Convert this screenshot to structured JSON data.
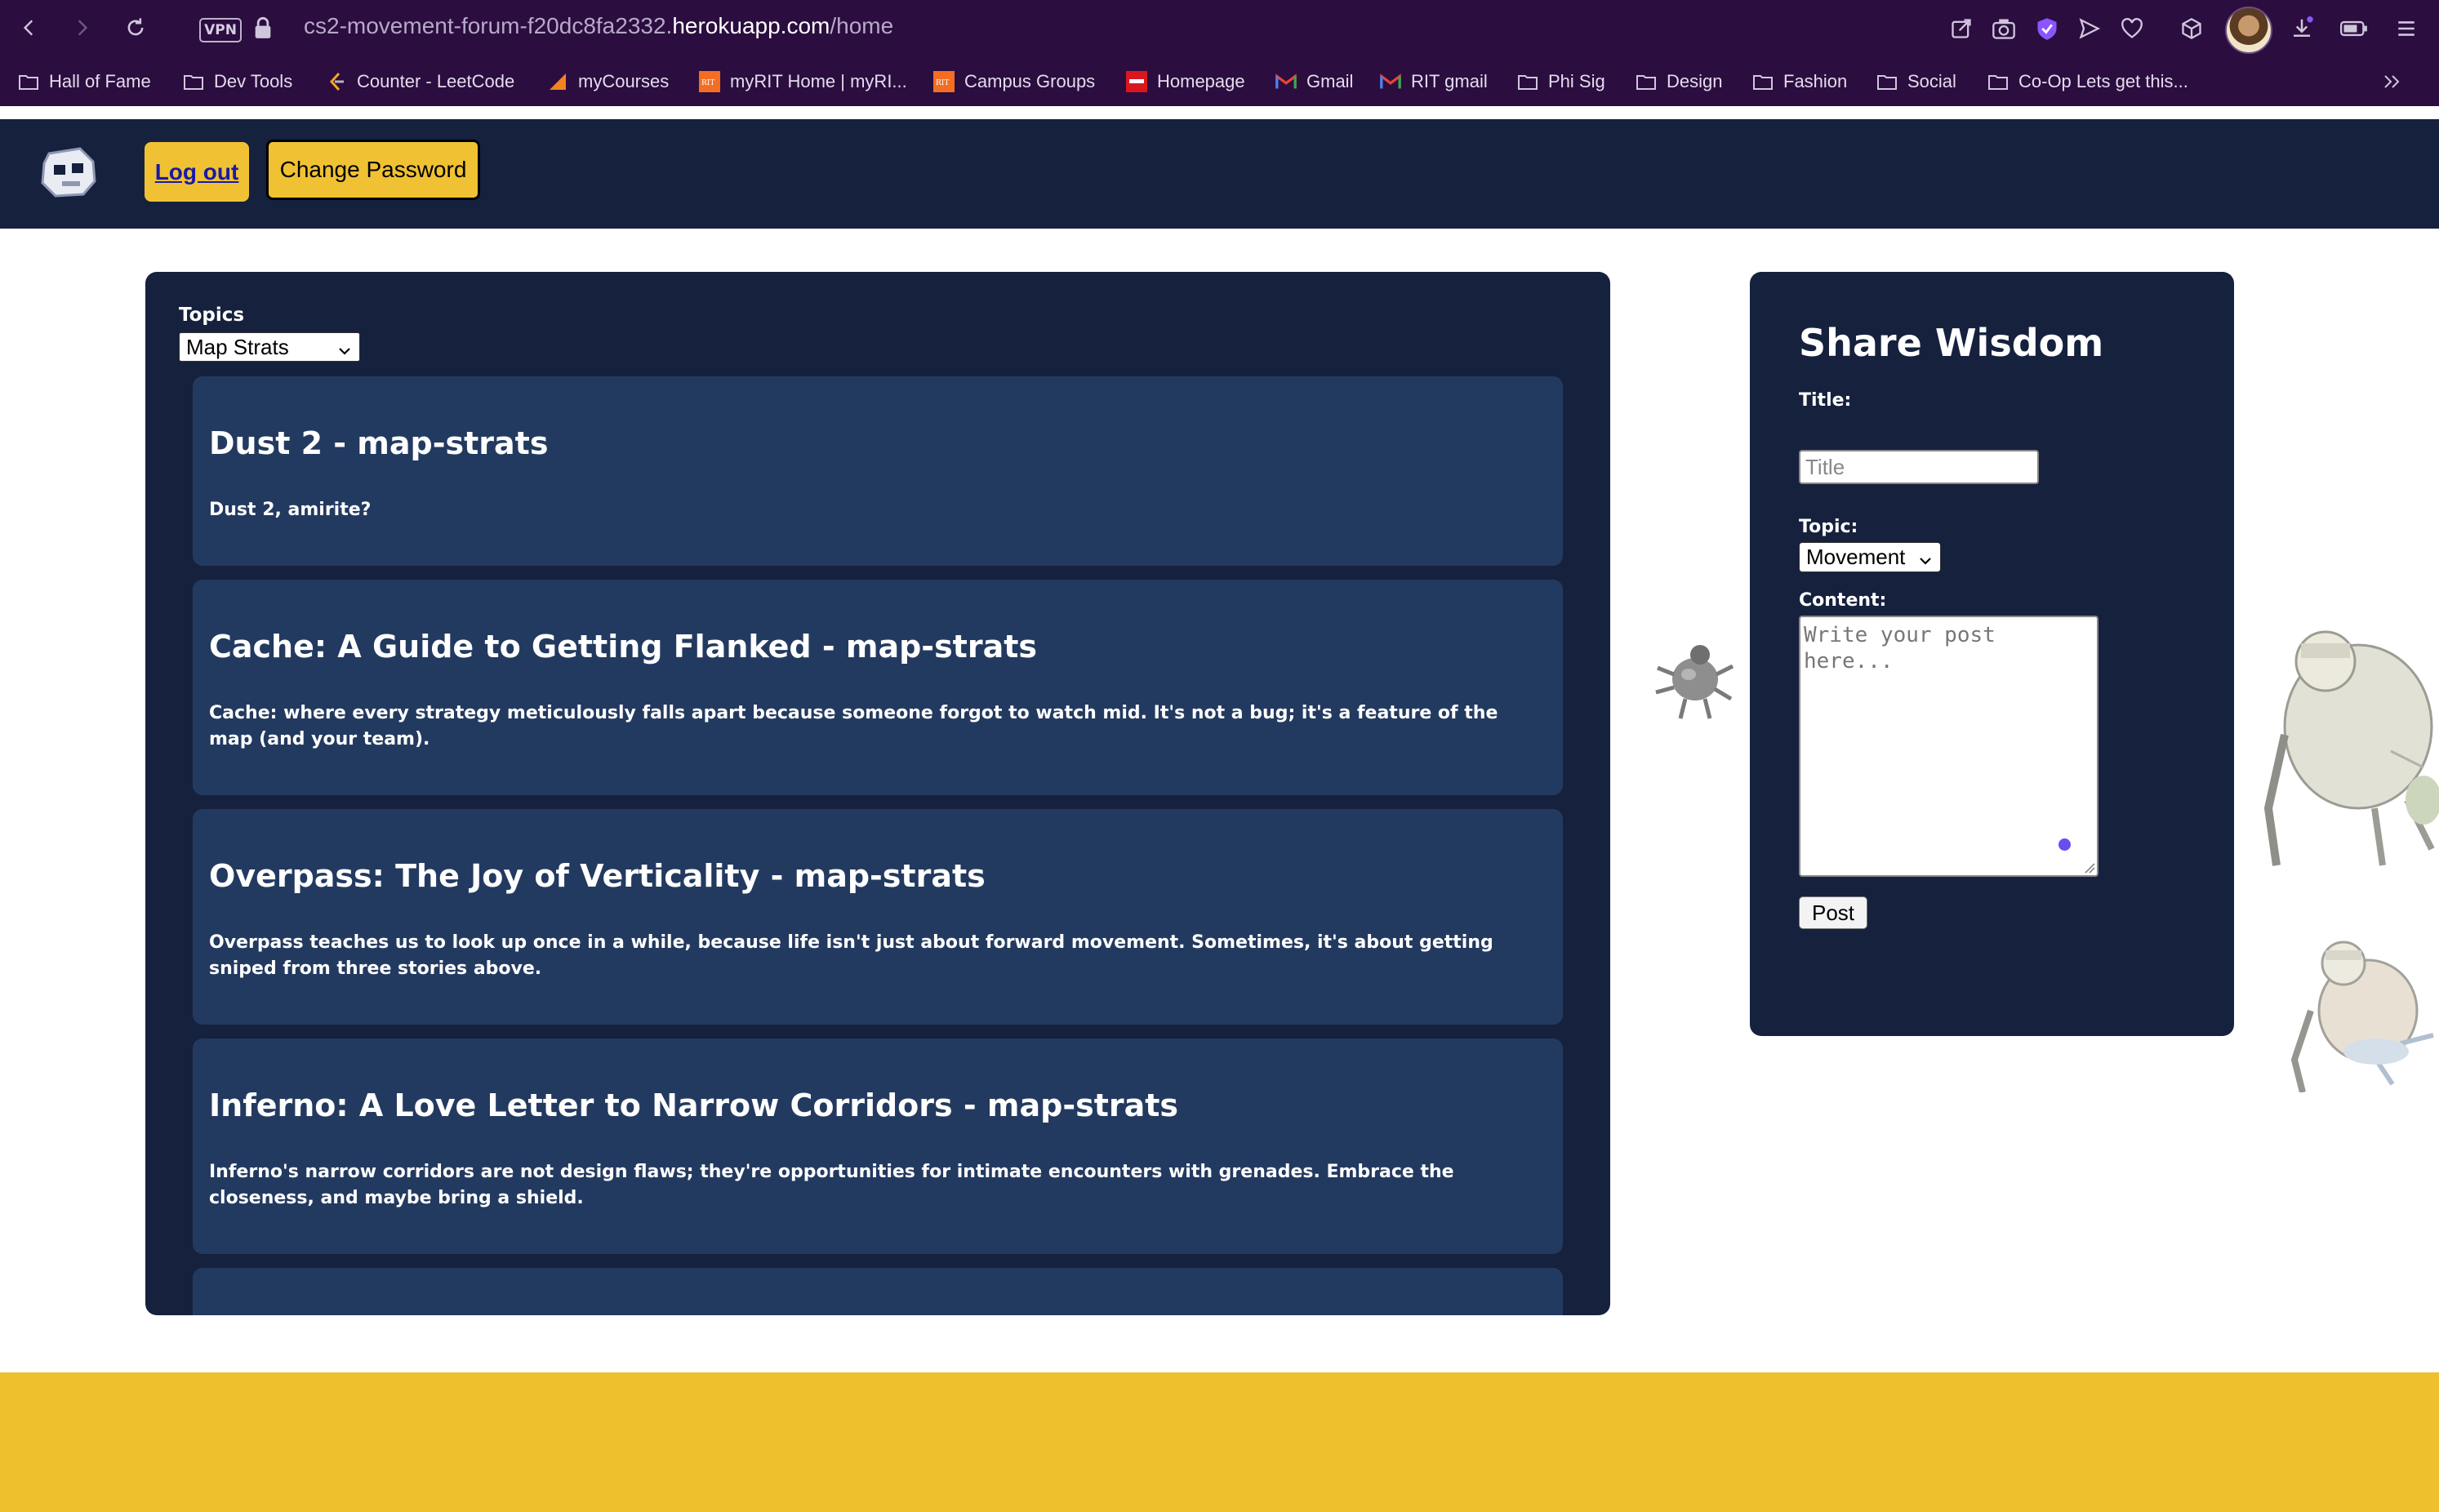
{
  "browser": {
    "vpn_label": "VPN",
    "url_prefix": "cs2-movement-forum-f20dc8fa2332.",
    "url_host": "herokuapp.com",
    "url_path": "/home",
    "bookmarks": [
      {
        "label": "Hall of Fame",
        "icon": "folder-icon"
      },
      {
        "label": "Dev Tools",
        "icon": "folder-icon"
      },
      {
        "label": "Counter - LeetCode",
        "icon": "leetcode-icon"
      },
      {
        "label": "myCourses",
        "icon": "mycourses-icon"
      },
      {
        "label": "myRIT Home | myRI...",
        "icon": "rit-icon"
      },
      {
        "label": "Campus Groups",
        "icon": "rit-icon"
      },
      {
        "label": "Homepage",
        "icon": "homepage-icon"
      },
      {
        "label": "Gmail",
        "icon": "gmail-icon"
      },
      {
        "label": "RIT gmail",
        "icon": "gmail-icon"
      },
      {
        "label": "Phi Sig",
        "icon": "folder-icon"
      },
      {
        "label": "Design",
        "icon": "folder-icon"
      },
      {
        "label": "Fashion",
        "icon": "folder-icon"
      },
      {
        "label": "Social",
        "icon": "folder-icon"
      },
      {
        "label": "Co-Op Lets get this...",
        "icon": "folder-icon"
      }
    ]
  },
  "header": {
    "logout_label": "Log out",
    "change_password_label": "Change Password"
  },
  "feed": {
    "topics_label": "Topics",
    "selected_topic": "Map Strats",
    "posts": [
      {
        "title": "Dust 2 - map-strats",
        "body": "Dust 2, amirite?"
      },
      {
        "title": "Cache: A Guide to Getting Flanked - map-strats",
        "body": "Cache: where every strategy meticulously falls apart because someone forgot to watch mid. It's not a bug; it's a feature of the map (and your team)."
      },
      {
        "title": "Overpass: The Joy of Verticality - map-strats",
        "body": "Overpass teaches us to look up once in a while, because life isn't just about forward movement. Sometimes, it's about getting sniped from three stories above."
      },
      {
        "title": "Inferno: A Love Letter to Narrow Corridors - map-strats",
        "body": "Inferno's narrow corridors are not design flaws; they're opportunities for intimate encounters with grenades. Embrace the closeness, and maybe bring a shield."
      }
    ]
  },
  "share": {
    "heading": "Share Wisdom",
    "title_label": "Title:",
    "title_placeholder": "Title",
    "topic_label": "Topic:",
    "selected_topic": "Movement",
    "content_label": "Content:",
    "content_placeholder": "Write your post here...",
    "post_label": "Post"
  },
  "colors": {
    "browser_bg": "#2b0d3f",
    "header_bg": "#15213d",
    "card_bg": "#233a60",
    "accent_yellow": "#f0c233",
    "footer_yellow": "#efc02e"
  }
}
